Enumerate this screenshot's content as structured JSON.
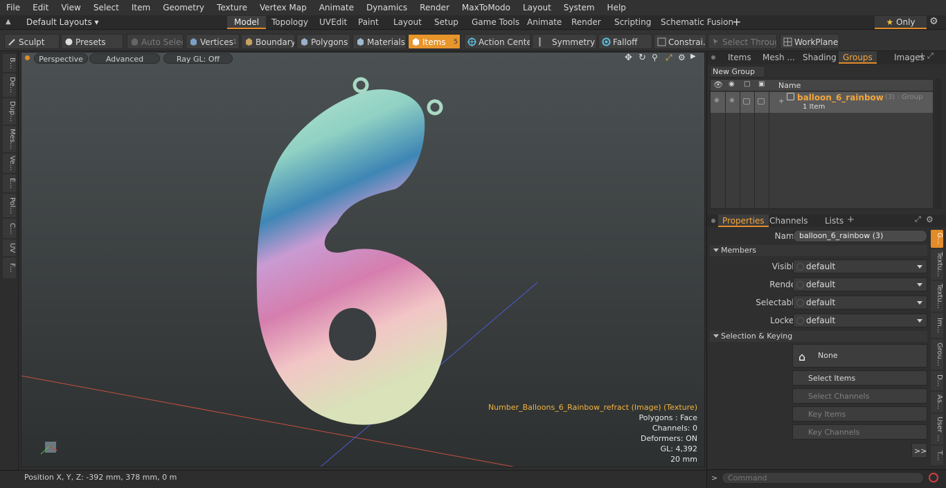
{
  "menu": [
    "File",
    "Edit",
    "View",
    "Select",
    "Item",
    "Geometry",
    "Texture",
    "Vertex Map",
    "Animate",
    "Dynamics",
    "Render",
    "MaxToModo",
    "Layout",
    "System",
    "Help"
  ],
  "layout_selector": "Default Layouts",
  "layout_tabs": [
    "Model",
    "Topology",
    "UVEdit",
    "Paint",
    "Layout",
    "Setup",
    "Game Tools",
    "Animate",
    "Render",
    "Scripting",
    "Schematic Fusion"
  ],
  "only_label": "Only",
  "toolbar": {
    "sculpt": "Sculpt",
    "presets": "Presets",
    "auto_select": "Auto Select",
    "vertices": "Vertices",
    "vertices_count": "1",
    "boundary": "Boundary",
    "polygons": "Polygons",
    "materials": "Materials",
    "items": "Items",
    "items_count": "5",
    "action_center": "Action Center",
    "symmetry": "Symmetry",
    "falloff": "Falloff",
    "constraints": "Constrai...",
    "select_through": "Select Through",
    "workplane": "WorkPlane"
  },
  "left_tabs": [
    "B...",
    "De...",
    "Dup...",
    "Mes...",
    "Ve...",
    "E...",
    "Pol...",
    "C...",
    "UV",
    "F..."
  ],
  "viewport": {
    "perspective": "Perspective",
    "advanced": "Advanced",
    "raygl": "Ray GL: Off",
    "info": [
      "Number_Balloons_6_Rainbow_refract (Image) (Texture)",
      "Polygons : Face",
      "Channels: 0",
      "Deformers: ON",
      "GL: 4,392",
      "20 mm"
    ]
  },
  "status": {
    "position": "Position X, Y, Z:  -392 mm, 378 mm, 0 m"
  },
  "right_top": {
    "tabs": [
      "Items",
      "Mesh ...",
      "Shading",
      "Groups",
      "Images"
    ],
    "new_group": "New Group",
    "name_header": "Name",
    "group_name": "balloon_6_rainbow",
    "group_suffix": "(3) : Group",
    "group_sub": "1 Item"
  },
  "properties": {
    "tabs": [
      "Properties",
      "Channels",
      "Lists"
    ],
    "name_label": "Name",
    "name_value": "balloon_6_rainbow (3)",
    "members": "Members",
    "visible_label": "Visible",
    "render_label": "Render",
    "selectable_label": "Selectable",
    "locked_label": "Locked",
    "default": "default",
    "sel_keying": "Selection & Keying",
    "none": "None",
    "select_items": "Select Items",
    "select_channels": "Select Channels",
    "key_items": "Key Items",
    "key_channels": "Key Channels",
    "more": ">>",
    "side_tabs": [
      "G...",
      "Textu...",
      "Textu...",
      "Im...",
      "Grou...",
      "D...",
      "As...",
      "User ...",
      "T..."
    ]
  },
  "command_placeholder": "Command"
}
